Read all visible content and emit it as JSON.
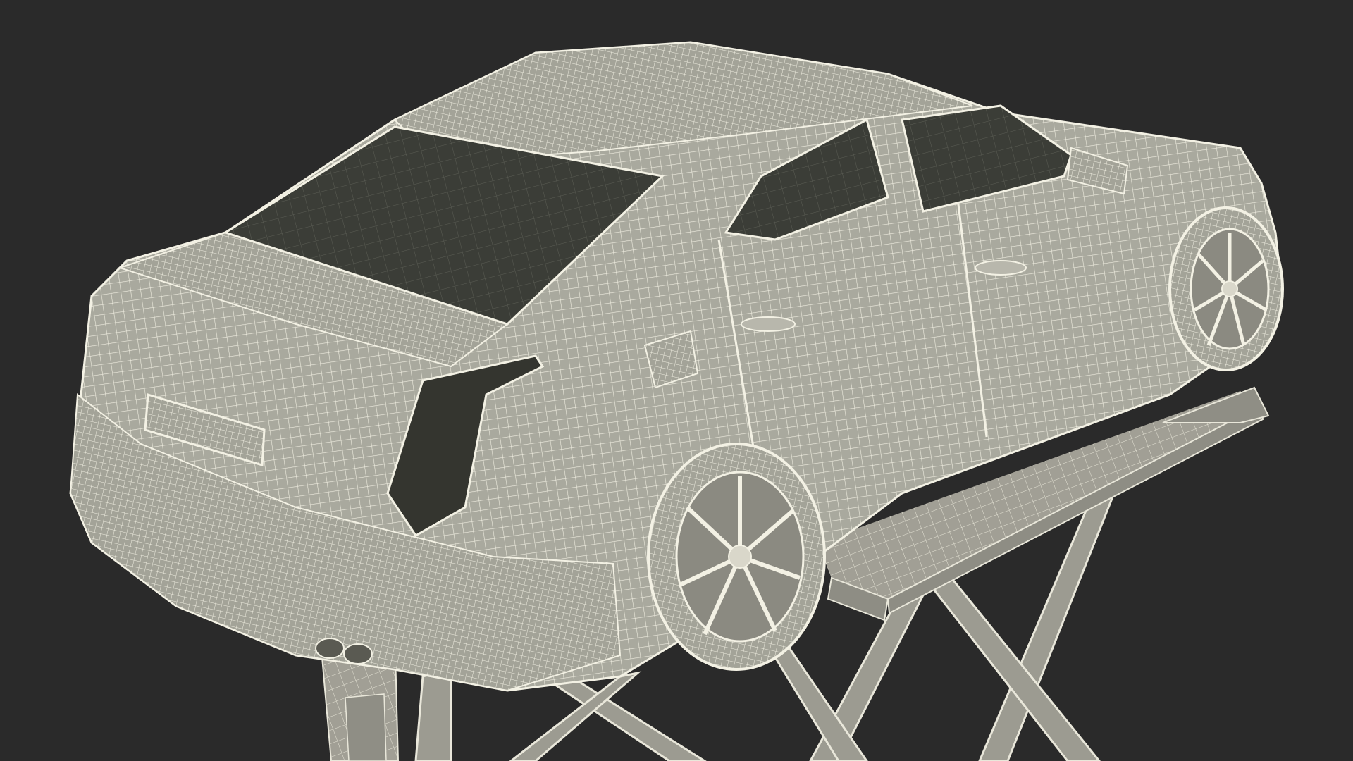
{
  "scene": {
    "background_color": "#2a2a2a",
    "body_color": "#a7a79c",
    "wire_color": "#f3f1e4",
    "glass_color": "#3d3f38",
    "lift_color": "#9c9c92"
  }
}
